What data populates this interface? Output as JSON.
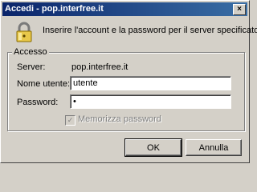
{
  "window": {
    "title": "Accedi - pop.interfree.it",
    "close_glyph": "×"
  },
  "message": "Inserire l'account e la password per il server specificato.",
  "group": {
    "legend": "Accesso",
    "server_label": "Server:",
    "server_value": "pop.interfree.it",
    "username_label": "Nome utente:",
    "username_value": "utente",
    "password_label": "Password:",
    "password_value": "•",
    "remember_label": "Memorizza password",
    "remember_checked": true,
    "remember_glyph": "✓"
  },
  "buttons": {
    "ok": "OK",
    "cancel": "Annulla"
  },
  "icons": {
    "lock": "padlock-icon"
  },
  "colors": {
    "title_bar_start": "#0a246a",
    "title_bar_end": "#3a6ea5",
    "face": "#d4d0c8"
  }
}
